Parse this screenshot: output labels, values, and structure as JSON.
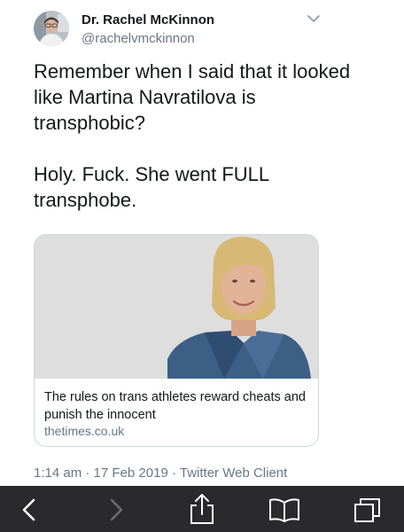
{
  "author": {
    "name": "Dr. Rachel McKinnon",
    "handle": "@rachelvmckinnon"
  },
  "tweet": {
    "paragraphs": [
      "Remember when I said that it looked like Martina Navratilova is transphobic?",
      "Holy. Fuck. She went FULL transphobe."
    ]
  },
  "link_card": {
    "title": "The rules on trans athletes reward cheats and punish the innocent",
    "domain": "thetimes.co.uk"
  },
  "meta": {
    "time": "1:14 am",
    "date": "17 Feb 2019",
    "client": "Twitter Web Client"
  },
  "icons": {
    "menu": "chevron-down-icon",
    "back": "back-arrow-icon",
    "forward": "forward-arrow-icon",
    "share": "share-icon",
    "bookmarks": "book-icon",
    "tabs": "tabs-icon"
  },
  "colors": {
    "text": "#14171a",
    "secondary": "#657786",
    "card_border": "#ccd6dd",
    "toolbar": "#2a2a2c"
  }
}
